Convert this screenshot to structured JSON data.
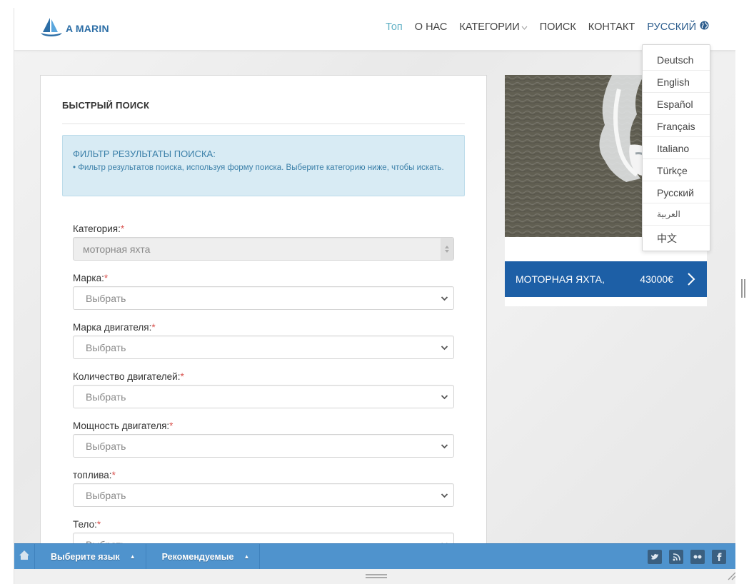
{
  "header": {
    "logo_text": "A MARIN",
    "nav": [
      {
        "label": "Топ"
      },
      {
        "label": "О НАС"
      },
      {
        "label": "КАТЕГОРИИ"
      },
      {
        "label": "ПОИСК"
      },
      {
        "label": "КОНТАКТ"
      },
      {
        "label": "РУССКИЙ"
      }
    ]
  },
  "language_menu": [
    "Deutsch",
    "English",
    "Español",
    "Français",
    "Italiano",
    "Türkçe",
    "Русский",
    "العربية",
    "中文"
  ],
  "search": {
    "title": "БЫСТРЫЙ ПОИСК",
    "info_title": "ФИЛЬТР РЕЗУЛЬТАТЫ ПОИСКА:",
    "info_text": "• Фильтр результатов поиска, используя форму поиска. Выберите категорию ниже, чтобы искать.",
    "required_mark": "*",
    "fields": [
      {
        "label": "Категория:",
        "value": "моторная яхта"
      },
      {
        "label": "Марка:",
        "value": "Выбрать"
      },
      {
        "label": "Марка двигателя:",
        "value": "Выбрать"
      },
      {
        "label": "Количество двигателей:",
        "value": "Выбрать"
      },
      {
        "label": "Мощность двигателя:",
        "value": "Выбрать"
      },
      {
        "label": "топлива:",
        "value": "Выбрать"
      },
      {
        "label": "Тело:",
        "value": "Выбрать"
      }
    ]
  },
  "featured": {
    "name": "МОТОРНАЯ ЯХТА,",
    "price": "43000€"
  },
  "bottombar": {
    "language": "Выберите язык",
    "featured": "Рекомендуемые",
    "socials": [
      "twitter-icon",
      "rss-icon",
      "flickr-icon",
      "facebook-icon"
    ]
  },
  "colors": {
    "brand_blue": "#1d5fa6",
    "bar_blue": "#4f93cd",
    "active_nav": "#5fb0c4"
  }
}
